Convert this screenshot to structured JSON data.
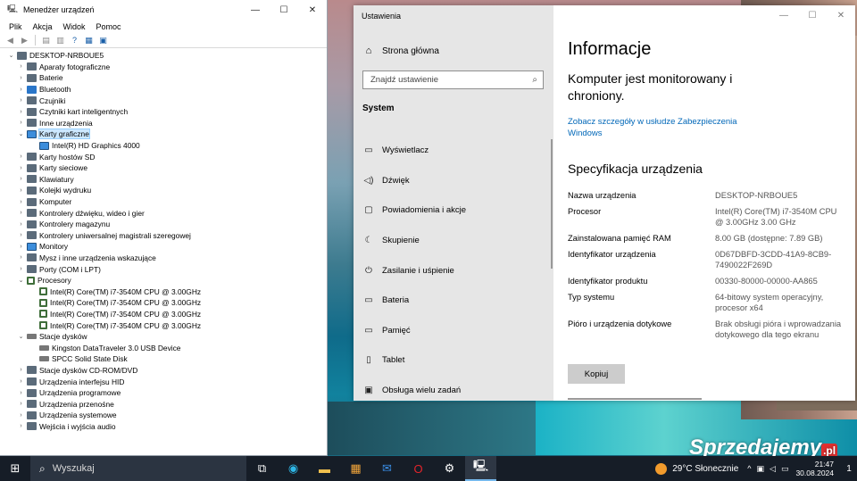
{
  "device_manager": {
    "title": "Menedżer urządzeń",
    "menu": [
      "Plik",
      "Akcja",
      "Widok",
      "Pomoc"
    ],
    "tree": [
      {
        "label": "DESKTOP-NRBOUE5",
        "level": 0,
        "exp": "v",
        "icon": "computer"
      },
      {
        "label": "Aparaty fotograficzne",
        "level": 1,
        "exp": ">",
        "icon": "camera"
      },
      {
        "label": "Baterie",
        "level": 1,
        "exp": ">",
        "icon": "battery"
      },
      {
        "label": "Bluetooth",
        "level": 1,
        "exp": ">",
        "icon": "bluetooth"
      },
      {
        "label": "Czujniki",
        "level": 1,
        "exp": ">",
        "icon": "sensor"
      },
      {
        "label": "Czytniki kart inteligentnych",
        "level": 1,
        "exp": ">",
        "icon": "smartcard"
      },
      {
        "label": "Inne urządzenia",
        "level": 1,
        "exp": ">",
        "icon": "other"
      },
      {
        "label": "Karty graficzne",
        "level": 1,
        "exp": "v",
        "icon": "display",
        "selected": true
      },
      {
        "label": "Intel(R) HD Graphics 4000",
        "level": 2,
        "exp": "",
        "icon": "display"
      },
      {
        "label": "Karty hostów SD",
        "level": 1,
        "exp": ">",
        "icon": "sd"
      },
      {
        "label": "Karty sieciowe",
        "level": 1,
        "exp": ">",
        "icon": "network"
      },
      {
        "label": "Klawiatury",
        "level": 1,
        "exp": ">",
        "icon": "keyboard"
      },
      {
        "label": "Kolejki wydruku",
        "level": 1,
        "exp": ">",
        "icon": "printer"
      },
      {
        "label": "Komputer",
        "level": 1,
        "exp": ">",
        "icon": "computer"
      },
      {
        "label": "Kontrolery dźwięku, wideo i gier",
        "level": 1,
        "exp": ">",
        "icon": "sound"
      },
      {
        "label": "Kontrolery magazynu",
        "level": 1,
        "exp": ">",
        "icon": "storage"
      },
      {
        "label": "Kontrolery uniwersalnej magistrali szeregowej",
        "level": 1,
        "exp": ">",
        "icon": "usb"
      },
      {
        "label": "Monitory",
        "level": 1,
        "exp": ">",
        "icon": "monitor"
      },
      {
        "label": "Mysz i inne urządzenia wskazujące",
        "level": 1,
        "exp": ">",
        "icon": "mouse"
      },
      {
        "label": "Porty (COM i LPT)",
        "level": 1,
        "exp": ">",
        "icon": "port"
      },
      {
        "label": "Procesory",
        "level": 1,
        "exp": "v",
        "icon": "cpu"
      },
      {
        "label": "Intel(R) Core(TM) i7-3540M CPU @ 3.00GHz",
        "level": 2,
        "exp": "",
        "icon": "cpu"
      },
      {
        "label": "Intel(R) Core(TM) i7-3540M CPU @ 3.00GHz",
        "level": 2,
        "exp": "",
        "icon": "cpu"
      },
      {
        "label": "Intel(R) Core(TM) i7-3540M CPU @ 3.00GHz",
        "level": 2,
        "exp": "",
        "icon": "cpu"
      },
      {
        "label": "Intel(R) Core(TM) i7-3540M CPU @ 3.00GHz",
        "level": 2,
        "exp": "",
        "icon": "cpu"
      },
      {
        "label": "Stacje dysków",
        "level": 1,
        "exp": "v",
        "icon": "disk"
      },
      {
        "label": "Kingston DataTraveler 3.0 USB Device",
        "level": 2,
        "exp": "",
        "icon": "disk"
      },
      {
        "label": "SPCC Solid State Disk",
        "level": 2,
        "exp": "",
        "icon": "disk"
      },
      {
        "label": "Stacje dysków CD-ROM/DVD",
        "level": 1,
        "exp": ">",
        "icon": "cdrom"
      },
      {
        "label": "Urządzenia interfejsu HID",
        "level": 1,
        "exp": ">",
        "icon": "hid"
      },
      {
        "label": "Urządzenia programowe",
        "level": 1,
        "exp": ">",
        "icon": "software"
      },
      {
        "label": "Urządzenia przenośne",
        "level": 1,
        "exp": ">",
        "icon": "portable"
      },
      {
        "label": "Urządzenia systemowe",
        "level": 1,
        "exp": ">",
        "icon": "system"
      },
      {
        "label": "Wejścia i wyjścia audio",
        "level": 1,
        "exp": ">",
        "icon": "audio"
      }
    ]
  },
  "settings": {
    "window_title": "Ustawienia",
    "home": "Strona główna",
    "search_placeholder": "Znajdź ustawienie",
    "section": "System",
    "nav": [
      {
        "label": "Wyświetlacz",
        "icon": "display-icon",
        "glyph": "▭"
      },
      {
        "label": "Dźwięk",
        "icon": "speaker-icon",
        "glyph": "◁)"
      },
      {
        "label": "Powiadomienia i akcje",
        "icon": "notification-icon",
        "glyph": "▢"
      },
      {
        "label": "Skupienie",
        "icon": "moon-icon",
        "glyph": "☾"
      },
      {
        "label": "Zasilanie i uśpienie",
        "icon": "power-icon",
        "glyph": "⏻"
      },
      {
        "label": "Bateria",
        "icon": "battery-icon",
        "glyph": "▭"
      },
      {
        "label": "Pamięć",
        "icon": "storage-icon",
        "glyph": "▭"
      },
      {
        "label": "Tablet",
        "icon": "tablet-icon",
        "glyph": "▯"
      },
      {
        "label": "Obsługa wielu zadań",
        "icon": "multitask-icon",
        "glyph": "▣"
      }
    ],
    "main": {
      "heading": "Informacje",
      "subtitle": "Komputer jest monitorowany i chroniony.",
      "link": "Zobacz szczegóły w usłudze Zabezpieczenia Windows",
      "spec_heading": "Specyfikacja urządzenia",
      "specs": [
        {
          "key": "Nazwa urządzenia",
          "value": "DESKTOP-NRBOUE5"
        },
        {
          "key": "Procesor",
          "value": "Intel(R) Core(TM) i7-3540M CPU @ 3.00GHz   3.00 GHz"
        },
        {
          "key": "Zainstalowana pamięć RAM",
          "value": "8.00 GB (dostępne: 7.89 GB)"
        },
        {
          "key": "Identyfikator urządzenia",
          "value": "0D67DBFD-3CDD-41A9-8CB9-7490022F269D"
        },
        {
          "key": "Identyfikator produktu",
          "value": "00330-80000-00000-AA865"
        },
        {
          "key": "Typ systemu",
          "value": "64-bitowy system operacyjny, procesor x64"
        },
        {
          "key": "Pióro i urządzenia dotykowe",
          "value": "Brak obsługi pióra i wprowadzania dotykowego dla tego ekranu"
        }
      ],
      "copy_button": "Kopiuj"
    }
  },
  "watermark": {
    "text": "Sprzedajemy",
    "suffix": ".pl"
  },
  "taskbar": {
    "search_label": "Wyszukaj",
    "apps": [
      "task-view-icon",
      "edge-icon",
      "file-explorer-icon",
      "store-icon",
      "mail-icon",
      "opera-icon",
      "settings-icon",
      "device-manager-icon"
    ],
    "weather": "29°C  Słonecznie",
    "time": "21:47",
    "date": "30.08.2024",
    "notifications": "1"
  }
}
